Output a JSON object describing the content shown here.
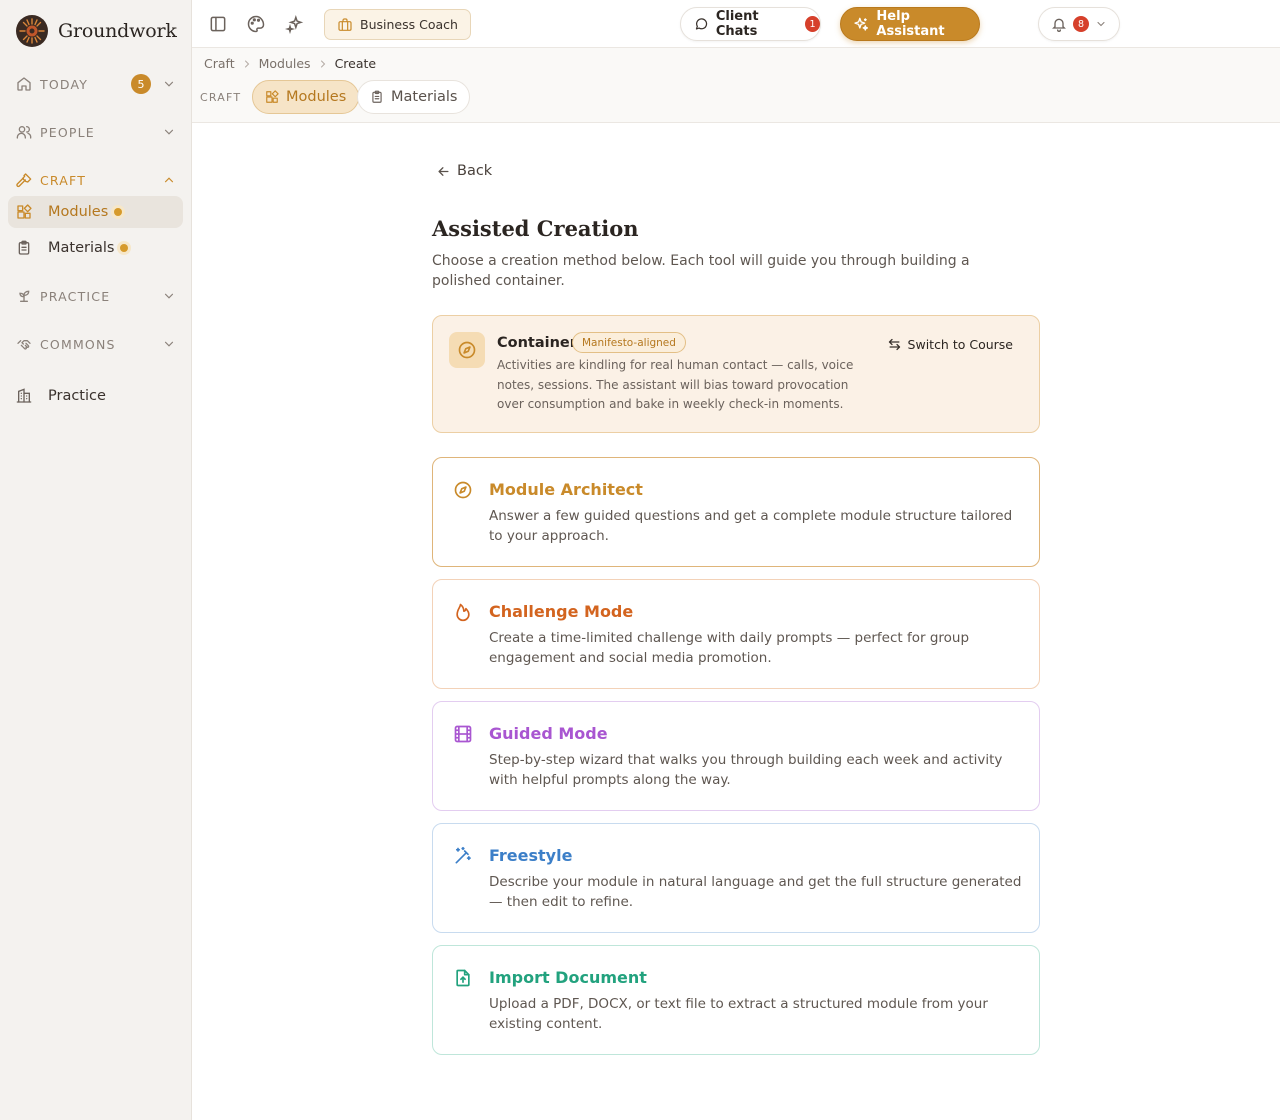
{
  "app": {
    "name": "Groundwork"
  },
  "sidebar": {
    "today": {
      "label": "TODAY",
      "count": "5"
    },
    "people": {
      "label": "PEOPLE"
    },
    "craft": {
      "label": "CRAFT"
    },
    "items": [
      {
        "label": "Modules",
        "icon": "modules-icon"
      },
      {
        "label": "Materials",
        "icon": "clipboard-icon"
      }
    ],
    "practice_section": {
      "label": "PRACTICE"
    },
    "commons": {
      "label": "COMMONS"
    },
    "practice_link": {
      "label": "Practice"
    }
  },
  "topbar": {
    "workspace": "Business Coach",
    "client_chats": {
      "label": "Client Chats",
      "count": "1"
    },
    "help": {
      "label": "Help Assistant"
    },
    "notifications": {
      "count": "8"
    }
  },
  "breadcrumb": [
    "Craft",
    "Modules",
    "Create"
  ],
  "subnav": {
    "section": "CRAFT",
    "tabs": [
      {
        "label": "Modules",
        "selected": true
      },
      {
        "label": "Materials",
        "selected": false
      }
    ]
  },
  "main": {
    "back": "Back",
    "title": "Assisted Creation",
    "subtitle": "Choose a creation method below. Each tool will guide you through building a polished container.",
    "container": {
      "title": "Container",
      "badge": "Manifesto-aligned",
      "description": "Activities are kindling for real human contact — calls, voice notes, sessions. The assistant will bias toward provocation over consumption and bake in weekly check-in moments.",
      "switch_label": "Switch to Course"
    },
    "tools": [
      {
        "title": "Module Architect",
        "description": "Answer a few guided questions and get a complete module structure tailored to your approach.",
        "color": "#c98a2a",
        "border": "#dfb57a",
        "icon": "compass-icon"
      },
      {
        "title": "Challenge Mode",
        "description": "Create a time-limited challenge with daily prompts — perfect for group engagement and social media promotion.",
        "color": "#d3641f",
        "border": "#f3d2b8",
        "icon": "flame-icon"
      },
      {
        "title": "Guided Mode",
        "description": "Step-by-step wizard that walks you through building each week and activity with helpful prompts along the way.",
        "color": "#a956d1",
        "border": "#e3cdf0",
        "icon": "film-icon"
      },
      {
        "title": "Freestyle",
        "description": "Describe your module in natural language and get the full structure generated — then edit to refine.",
        "color": "#3c7fc8",
        "border": "#c8dbef",
        "icon": "magic-wand-icon"
      },
      {
        "title": "Import Document",
        "description": "Upload a PDF, DOCX, or text file to extract a structured module from your existing content.",
        "color": "#22a27e",
        "border": "#bfe6da",
        "icon": "file-upload-icon"
      }
    ]
  }
}
